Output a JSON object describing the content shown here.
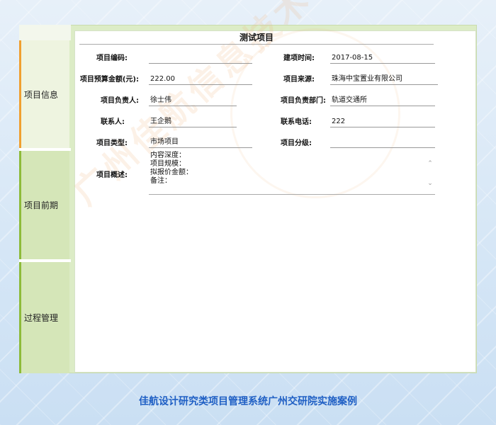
{
  "sidebar": {
    "items": [
      {
        "label": "项目信息"
      },
      {
        "label": "项目前期"
      },
      {
        "label": "过程管理"
      }
    ]
  },
  "form": {
    "title": "测试项目",
    "fields": {
      "project_code": {
        "label": "项目编码:",
        "value": ""
      },
      "build_time": {
        "label": "建项时间:",
        "value": "2017-08-15"
      },
      "budget": {
        "label": "项目预算金额(元):",
        "value": "222.00"
      },
      "source": {
        "label": "项目来源:",
        "value": "珠海中宝置业有限公司"
      },
      "manager": {
        "label": "项目负责人:",
        "value": "徐士伟"
      },
      "department": {
        "label": "项目负责部门:",
        "value": "轨道交通所"
      },
      "contact": {
        "label": "联系人:",
        "value": "王企鹅"
      },
      "phone": {
        "label": "联系电话:",
        "value": "222"
      },
      "type": {
        "label": "项目类型:",
        "value": "市场项目"
      },
      "level": {
        "label": "项目分级:",
        "value": ""
      },
      "description": {
        "label": "项目概述:",
        "lines": [
          "内容深度：",
          "项目规模：",
          "拟报价金额：",
          "备注："
        ]
      }
    }
  },
  "watermark": {
    "text": "广州佳航信息技术有限公司"
  },
  "footer": {
    "caption": "佳航设计研究类项目管理系统广州交研院实施案例"
  }
}
